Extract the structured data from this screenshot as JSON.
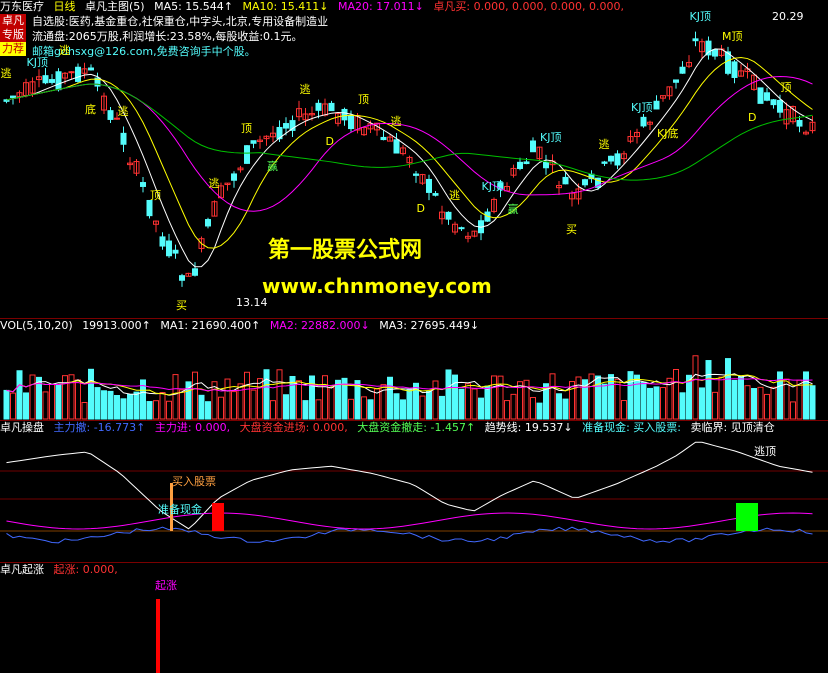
{
  "main": {
    "stock_name": "万东医疗",
    "period": "日线",
    "indicator_name": "卓凡主图(5)",
    "ma5": "MA5: 15.544↑",
    "ma10": "MA10: 15.411↓",
    "ma20": "MA20: 17.011↓",
    "extra_label": "卓凡买: 0.000, 0.000, 0.000, 0.000,",
    "info_line1": "自选股:医药,基金重仓,社保重仓,中字头,北京,专用设备制造业",
    "info_line2": "流通盘:2065万股,利润增长:23.58%,每股收益:0.1元。",
    "info_line3": "邮箱gdhsxg@126.com,免费咨询手中个股。",
    "badge1": "卓凡",
    "badge2": "专版",
    "badge3": "力荐",
    "high_label": "20.29",
    "low_label": "13.14",
    "watermark_cn": "第一股票公式网",
    "watermark_url": "www.chnmoney.com",
    "signals": [
      "逃",
      "顶",
      "KJ顶",
      "M顶",
      "顶",
      "逃",
      "KJ顶",
      "逃",
      "逃",
      "KJ顶",
      "顶",
      "逃",
      "逃",
      "KJ顶",
      "逃",
      "顶",
      "逃",
      "KJ顶",
      "赢",
      "赢",
      "D",
      "买",
      "D",
      "KJ底",
      "底",
      "D",
      "买"
    ]
  },
  "volume": {
    "label": "VOL(5,10,20)",
    "value": "19913.000↑",
    "ma1": "MA1: 21690.400↑",
    "ma2": "MA2: 22882.000↓",
    "ma3": "MA3: 27695.449↓"
  },
  "operate": {
    "label": "卓凡操盘",
    "zlc": "主力撤: -16.773↑",
    "zlj": "主力进: 0.000,",
    "dpj": "大盘资金进场: 0.000,",
    "dpc": "大盘资金撤走: -1.457↑",
    "trend": "趋势线: 19.537↓",
    "prep": "准备现金: 买入股票:",
    "sell": "卖临界: 见顶清仓",
    "buy_tag": "买入股票",
    "cash_tag": "准备现金",
    "escape_tag": "逃顶"
  },
  "rise": {
    "label": "卓凡起涨",
    "value": "起涨: 0.000,",
    "tag": "起涨"
  },
  "colors": {
    "up": "#ff3232",
    "down": "#54fcfc",
    "bg": "#000000",
    "sep": "#7a0000"
  }
}
